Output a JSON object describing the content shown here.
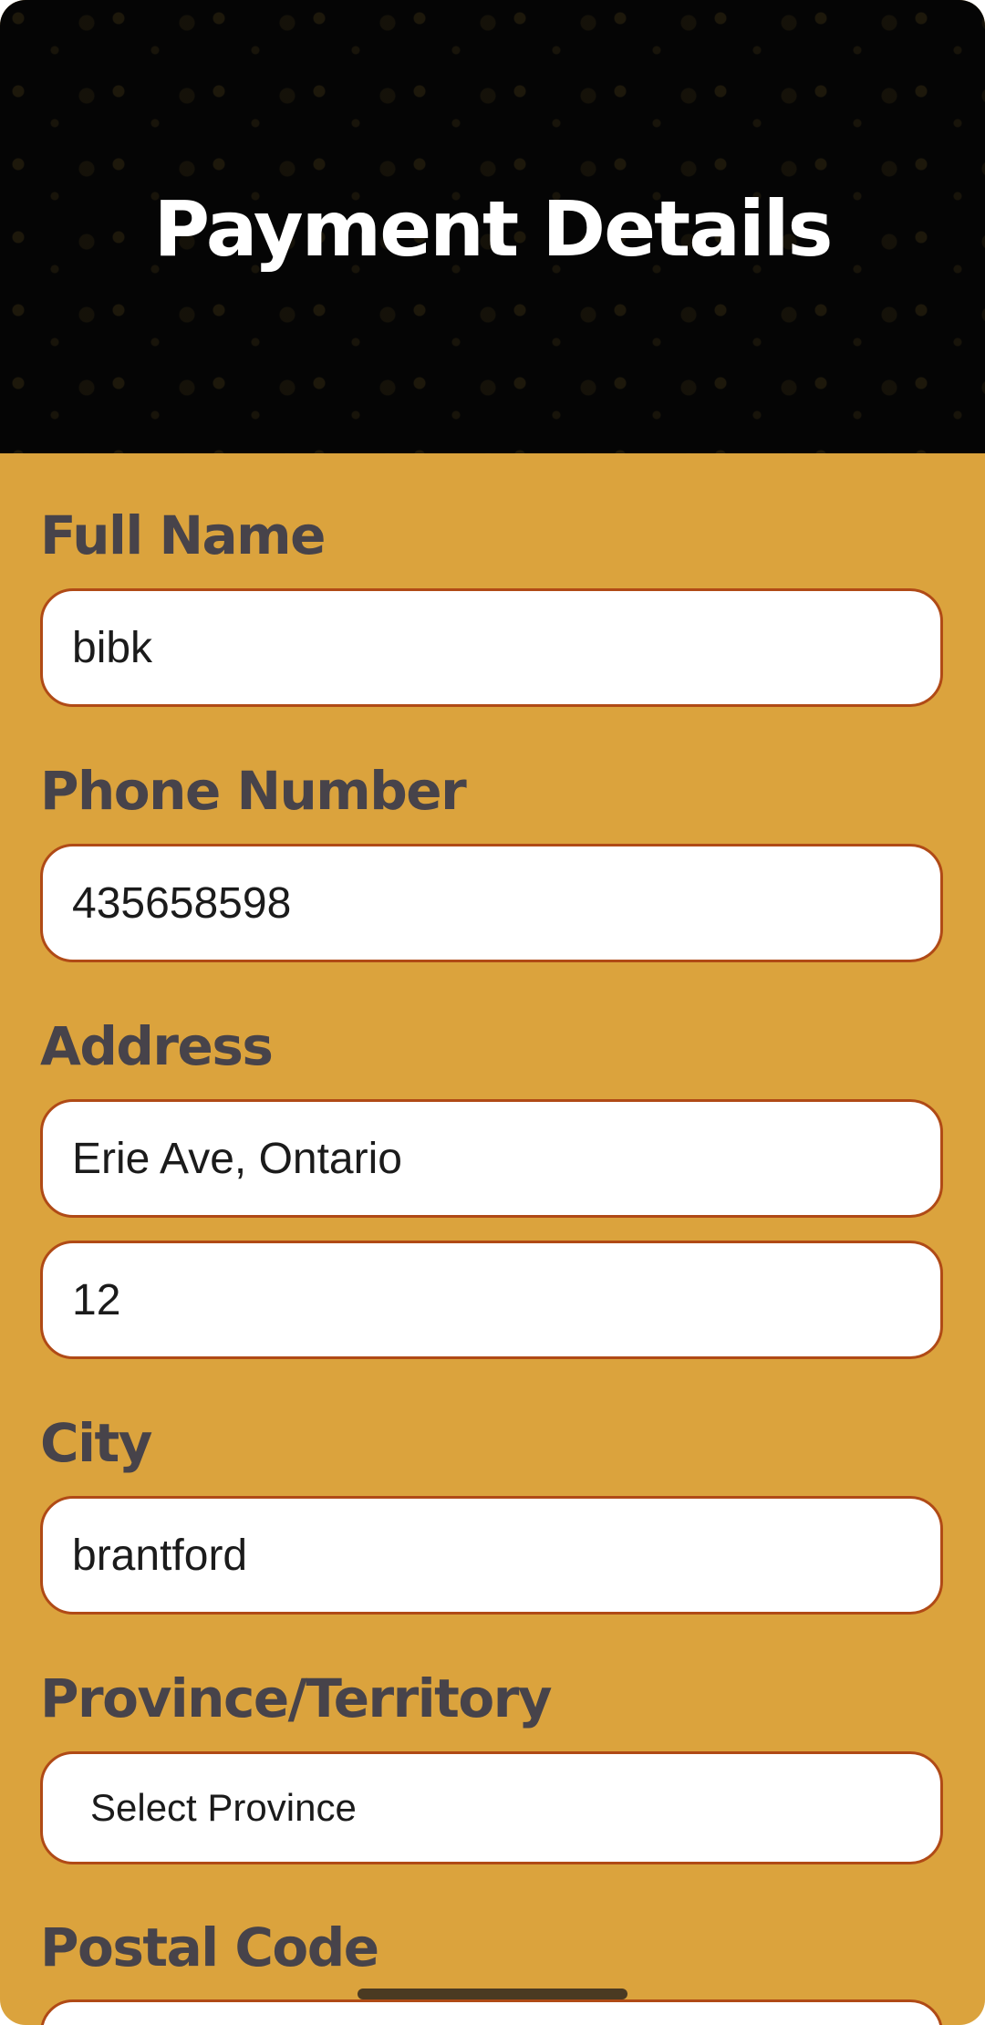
{
  "header": {
    "title": "Payment Details"
  },
  "form": {
    "full_name": {
      "label": "Full Name",
      "value": "bibk"
    },
    "phone": {
      "label": "Phone Number",
      "value": "435658598"
    },
    "address": {
      "label": "Address",
      "line1_value": "Erie Ave, Ontario",
      "line2_value": "12"
    },
    "city": {
      "label": "City",
      "value": "brantford"
    },
    "province": {
      "label": "Province/Territory",
      "selected": "Select Province"
    },
    "postal_code": {
      "label": "Postal Code",
      "value": ""
    }
  },
  "colors": {
    "background": "#DBA33D",
    "header_bg": "#050505",
    "label_text": "#47434A",
    "field_border": "#B04A16"
  }
}
